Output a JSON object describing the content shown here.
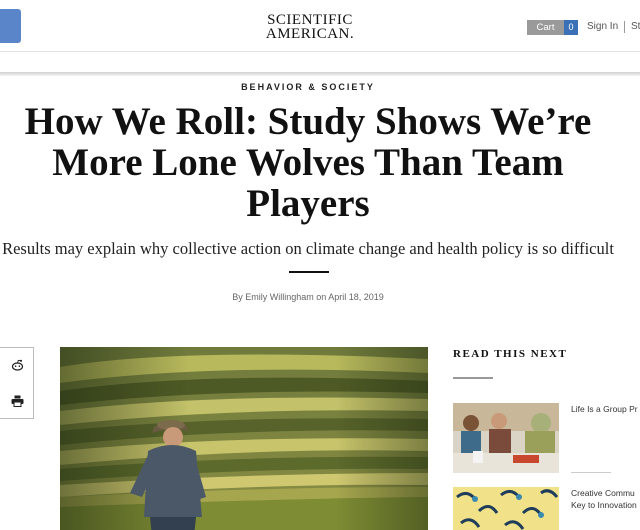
{
  "header": {
    "logo_line1": "SCIENTIFIC",
    "logo_line2": "AMERICAN.",
    "cart_label": "Cart",
    "cart_count": "0",
    "sign_in": "Sign In",
    "sign_in_extra": "St"
  },
  "article": {
    "category": "BEHAVIOR & SOCIETY",
    "title": "How We Roll: Study Shows We’re More Lone Wolves Than Team Players",
    "dek": "Results may explain why collective action on climate change and health policy is so difficult",
    "byline": "By Emily Willingham on April 18, 2019"
  },
  "share": {
    "icons": [
      "reddit-icon",
      "print-icon"
    ]
  },
  "read_next": {
    "title": "READ THIS NEXT",
    "items": [
      {
        "label": "Life Is a Group Pr"
      },
      {
        "label": "Creative Commu",
        "label2": "Key to Innovation"
      }
    ]
  },
  "colors": {
    "menu_button": "#5a85c9",
    "cart_gray": "#9a9a9a",
    "cart_blue": "#3b6fb6"
  }
}
